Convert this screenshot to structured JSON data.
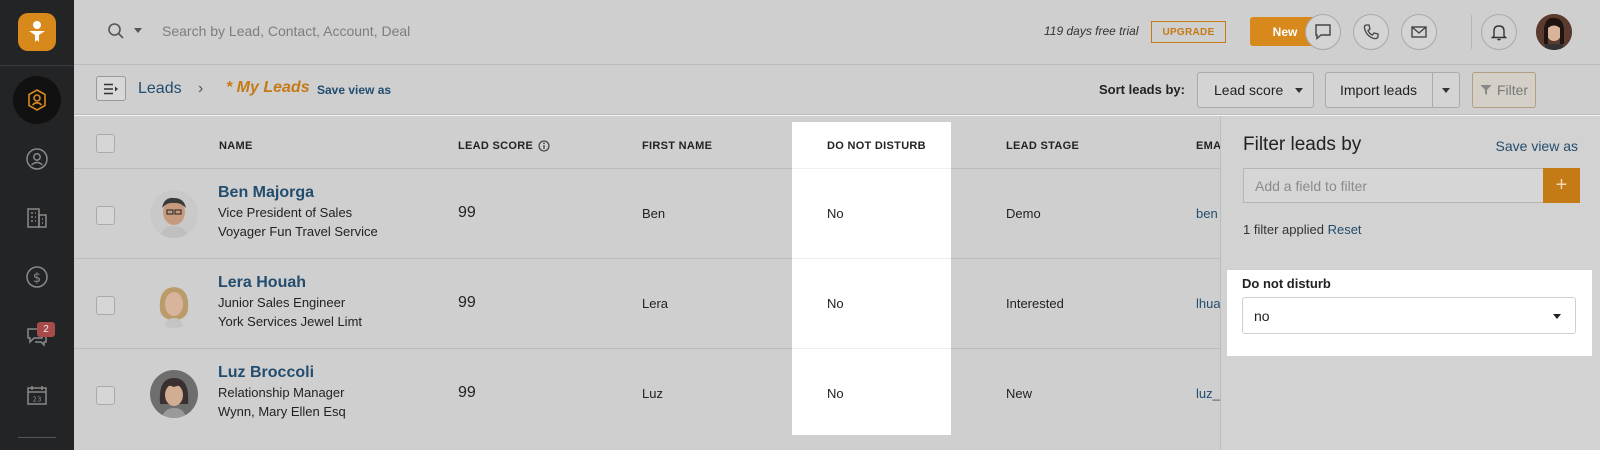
{
  "topbar": {
    "search_placeholder": "Search by Lead, Contact, Account, Deal",
    "trial_text": "119 days free trial",
    "upgrade_label": "UPGRADE",
    "new_label": "New"
  },
  "sidebar": {
    "chat_badge": "2"
  },
  "subbar": {
    "breadcrumb_root": "Leads",
    "breadcrumb_sep": "›",
    "breadcrumb_current": "* My Leads",
    "save_view": "Save view as",
    "sort_label": "Sort leads by:",
    "sort_value": "Lead score",
    "import_label": "Import leads",
    "filter_label": "Filter"
  },
  "table": {
    "columns": {
      "name": "NAME",
      "lead_score": "LEAD SCORE",
      "first_name": "FIRST NAME",
      "do_not_disturb": "DO NOT DISTURB",
      "lead_stage": "LEAD STAGE",
      "email": "EMA"
    },
    "rows": [
      {
        "name": "Ben Majorga",
        "title": "Vice President of Sales",
        "company": "Voyager Fun Travel Service",
        "score": "99",
        "first_name": "Ben",
        "dnd": "No",
        "stage": "Demo",
        "email": "ben"
      },
      {
        "name": "Lera Houah",
        "title": "Junior Sales Engineer",
        "company": "York Services Jewel Limt",
        "score": "99",
        "first_name": "Lera",
        "dnd": "No",
        "stage": "Interested",
        "email": "lhua"
      },
      {
        "name": "Luz Broccoli",
        "title": "Relationship Manager",
        "company": "Wynn, Mary Ellen Esq",
        "score": "99",
        "first_name": "Luz",
        "dnd": "No",
        "stage": "New",
        "email": "luz_"
      }
    ]
  },
  "panel": {
    "title": "Filter leads by",
    "save_view": "Save view as",
    "add_placeholder": "Add a field to filter",
    "plus": "+",
    "applied_text": "1 filter applied",
    "reset": "Reset",
    "filter_label": "Do not disturb",
    "filter_value": "no"
  },
  "colors": {
    "accent": "#d8891c",
    "link": "#234d6e",
    "sidebar": "#222426"
  }
}
